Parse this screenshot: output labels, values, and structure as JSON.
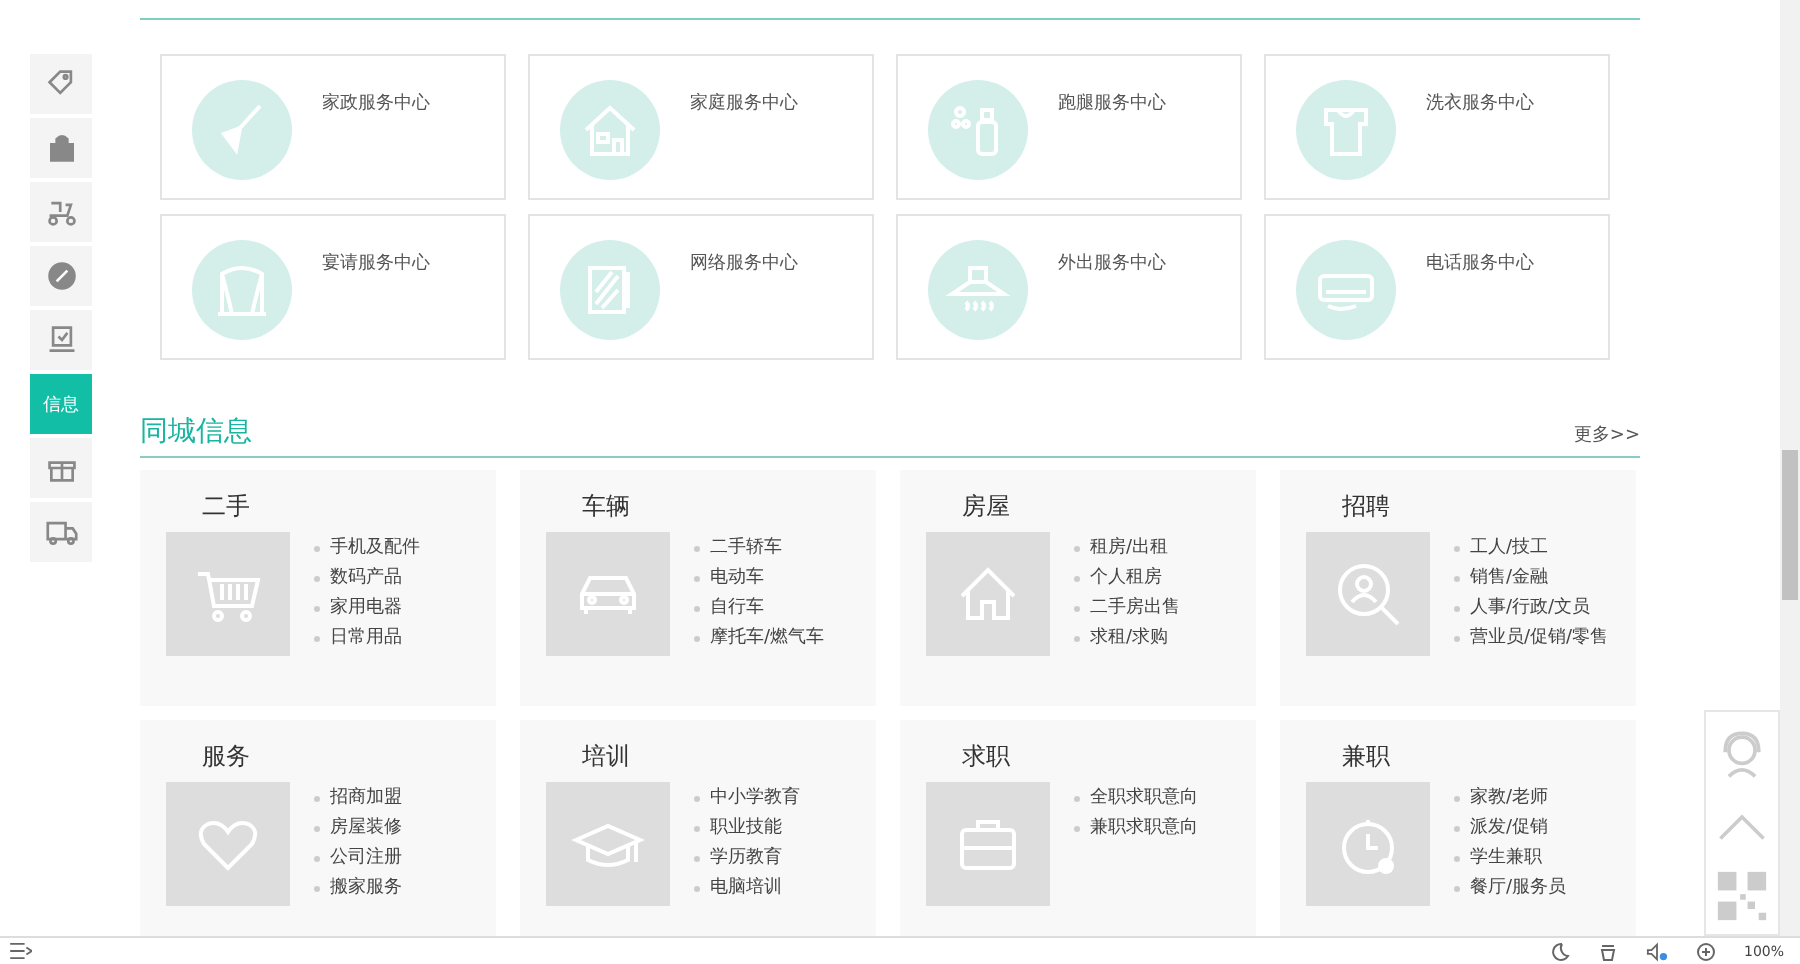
{
  "side_nav": [
    {
      "kind": "icon",
      "selected": false
    },
    {
      "kind": "icon",
      "selected": false
    },
    {
      "kind": "icon",
      "selected": false
    },
    {
      "kind": "icon",
      "selected": false
    },
    {
      "kind": "icon",
      "selected": false
    },
    {
      "kind": "text",
      "label": "信息",
      "selected": true
    },
    {
      "kind": "icon",
      "selected": false
    },
    {
      "kind": "icon",
      "selected": false
    }
  ],
  "services": [
    {
      "name": "家政服务中心"
    },
    {
      "name": "家庭服务中心"
    },
    {
      "name": "跑腿服务中心"
    },
    {
      "name": "洗衣服务中心"
    },
    {
      "name": "宴请服务中心"
    },
    {
      "name": "网络服务中心"
    },
    {
      "name": "外出服务中心"
    },
    {
      "name": "电话服务中心"
    }
  ],
  "city_info": {
    "title": "同城信息",
    "more": "更多>>",
    "categories": [
      {
        "title": "二手",
        "items": [
          "手机及配件",
          "数码产品",
          "家用电器",
          "日常用品"
        ]
      },
      {
        "title": "车辆",
        "items": [
          "二手轿车",
          "电动车",
          "自行车",
          "摩托车/燃气车"
        ]
      },
      {
        "title": "房屋",
        "items": [
          "租房/出租",
          "个人租房",
          "二手房出售",
          "求租/求购"
        ]
      },
      {
        "title": "招聘",
        "items": [
          "工人/技工",
          "销售/金融",
          "人事/行政/文员",
          "营业员/促销/零售"
        ]
      },
      {
        "title": "服务",
        "items": [
          "招商加盟",
          "房屋装修",
          "公司注册",
          "搬家服务"
        ]
      },
      {
        "title": "培训",
        "items": [
          "中小学教育",
          "职业技能",
          "学历教育",
          "电脑培训"
        ]
      },
      {
        "title": "求职",
        "items": [
          "全职求职意向",
          "兼职求职意向"
        ]
      },
      {
        "title": "兼职",
        "items": [
          "家教/老师",
          "派发/促销",
          "学生兼职",
          "餐厅/服务员"
        ]
      }
    ]
  },
  "status_bar": {
    "zoom": "100%"
  }
}
